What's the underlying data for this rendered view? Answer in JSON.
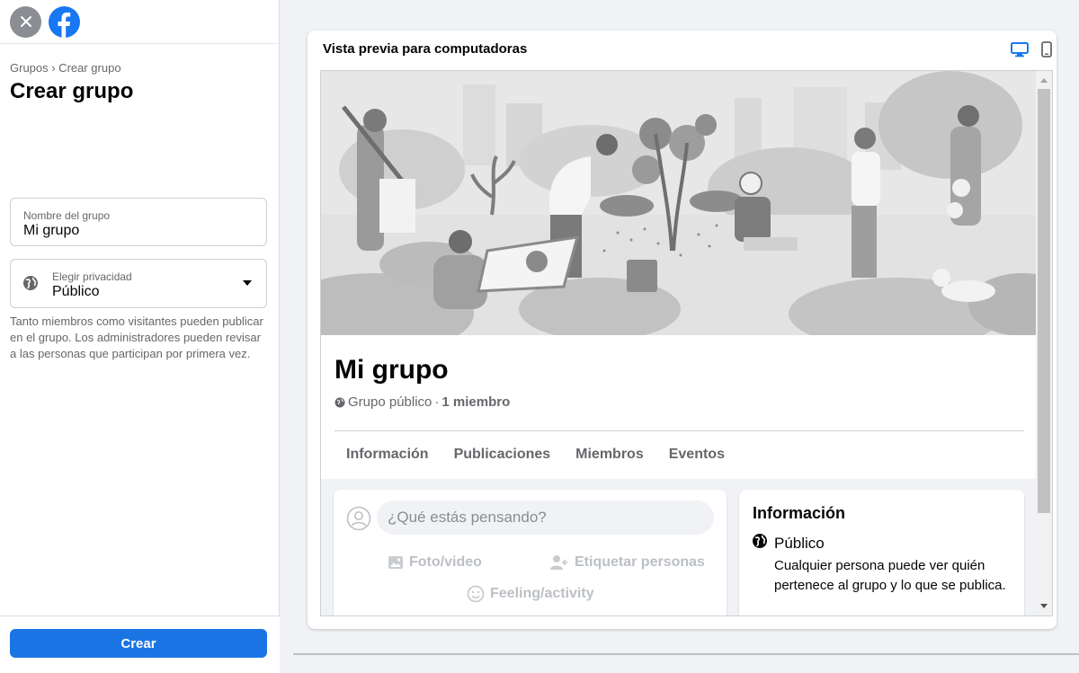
{
  "left": {
    "breadcrumb": "Grupos › Crear grupo",
    "title": "Crear grupo",
    "name_field": {
      "label": "Nombre del grupo",
      "value": "Mi grupo"
    },
    "privacy_field": {
      "label": "Elegir privacidad",
      "value": "Público"
    },
    "help_text": "Tanto miembros como visitantes pueden publicar en el grupo. Los administradores pueden revisar a las personas que participan por primera vez.",
    "create_button": "Crear"
  },
  "preview": {
    "title": "Vista previa para computadoras",
    "group_name": "Mi grupo",
    "group_type": "Grupo público",
    "separator": "·",
    "members": "1 miembro",
    "tabs": [
      "Información",
      "Publicaciones",
      "Miembros",
      "Eventos"
    ],
    "composer": {
      "placeholder": "¿Qué estás pensando?",
      "photo_video": "Foto/video",
      "tag_people": "Etiquetar personas",
      "feeling": "Feeling/activity"
    },
    "info_card": {
      "heading": "Información",
      "privacy_title": "Público",
      "privacy_desc": "Cualquier persona puede ver quién pertenece al grupo y lo que se publica."
    }
  },
  "colors": {
    "brand_blue": "#1877f2",
    "button_blue": "#1b74e4",
    "secondary_text": "#65676b"
  },
  "icons": [
    "close-icon",
    "facebook-logo",
    "globe-icon",
    "dropdown-caret-icon",
    "desktop-icon",
    "mobile-icon",
    "avatar-icon",
    "photo-icon",
    "tag-people-icon",
    "feeling-icon"
  ]
}
